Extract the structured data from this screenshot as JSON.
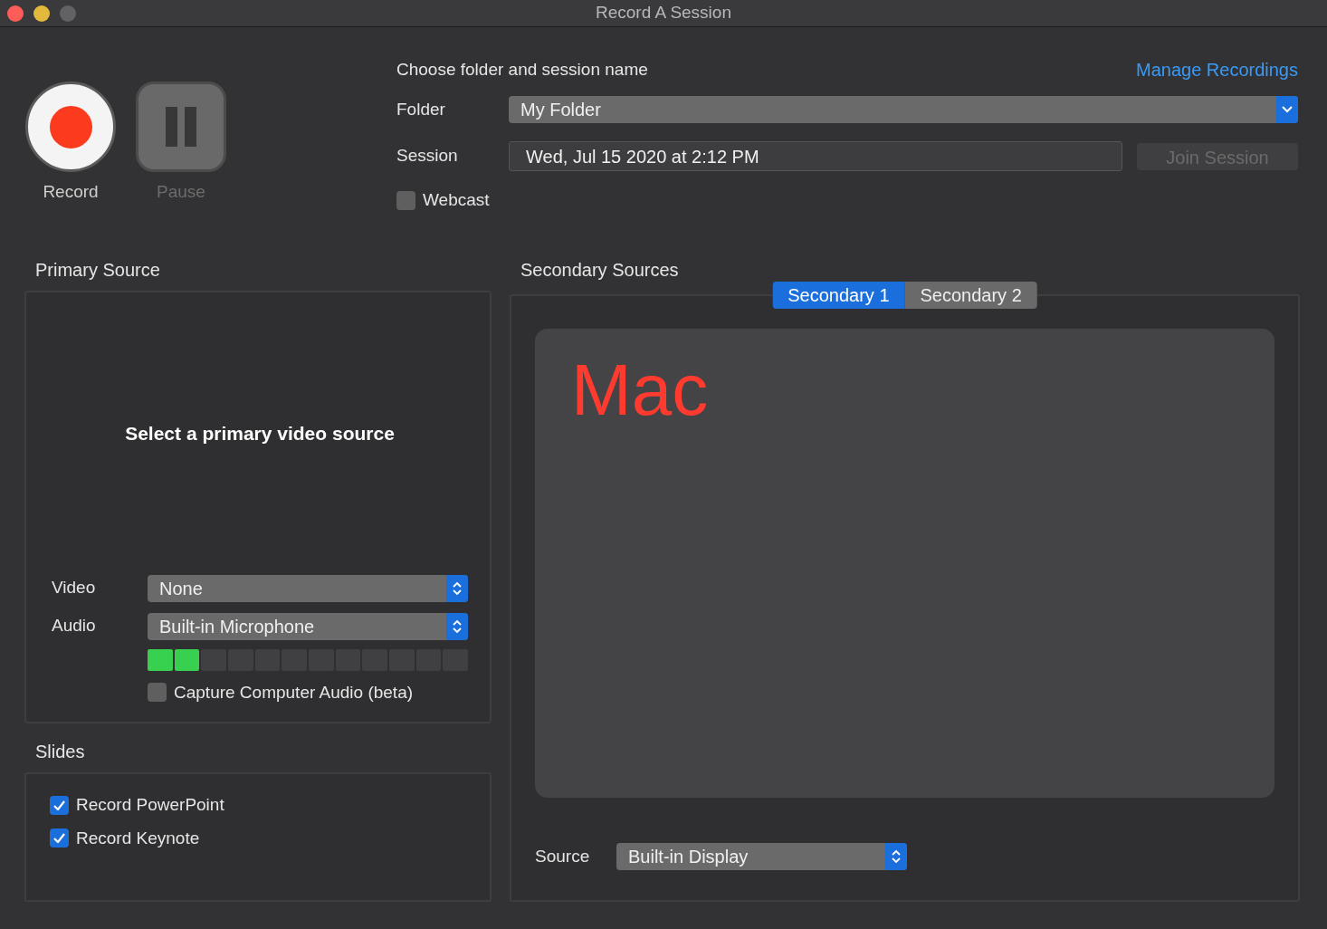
{
  "window": {
    "title": "Record A Session"
  },
  "controls": [
    {
      "label": "Record",
      "disabled": false
    },
    {
      "label": "Pause",
      "disabled": true
    }
  ],
  "session_form": {
    "heading": "Choose folder and session name",
    "link": "Manage Recordings",
    "folder": {
      "label": "Folder",
      "value": "My Folder"
    },
    "session": {
      "label": "Session",
      "value": "Wed, Jul 15 2020 at 2:12 PM"
    },
    "join_button": {
      "label": "Join Session",
      "disabled": true
    },
    "webcast": {
      "label": "Webcast",
      "checked": false
    }
  },
  "primary_source": {
    "title": "Primary Source",
    "prompt": "Select a primary video source",
    "video": {
      "label": "Video",
      "value": "None"
    },
    "audio": {
      "label": "Audio",
      "value": "Built-in Microphone",
      "level": 0.17
    },
    "capture_audio": {
      "label": "Capture Computer Audio (beta)",
      "checked": false
    }
  },
  "slides": {
    "title": "Slides",
    "options": [
      {
        "label": "Record PowerPoint",
        "checked": true
      },
      {
        "label": "Record Keynote",
        "checked": true
      }
    ]
  },
  "secondary_sources": {
    "title": "Secondary Sources",
    "tabs": [
      {
        "label": "Secondary 1",
        "selected": true
      },
      {
        "label": "Secondary 2",
        "selected": false
      }
    ],
    "preview_text": "Mac",
    "source": {
      "label": "Source",
      "value": "Built-in Display"
    }
  }
}
